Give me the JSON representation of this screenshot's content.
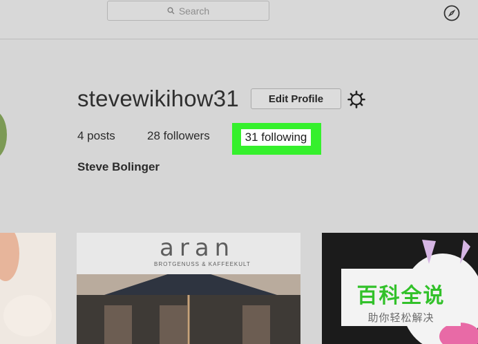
{
  "search": {
    "placeholder": "Search"
  },
  "profile": {
    "username": "stevewikihow31",
    "edit_label": "Edit Profile",
    "posts": "4 posts",
    "followers": "28 followers",
    "following": "31 following",
    "full_name": "Steve Bolinger"
  },
  "posts_grid": {
    "tile2": {
      "sign_word": "aran",
      "sign_sub": "BROTGENUSS & KAFFEEKULT"
    }
  },
  "watermark": {
    "title": "百科全说",
    "subtitle": "助你轻松解决"
  },
  "colors": {
    "highlight": "#35f02c",
    "watermark_green": "#32c12a"
  },
  "icons": [
    "search-icon",
    "compass-icon",
    "gear-icon"
  ]
}
